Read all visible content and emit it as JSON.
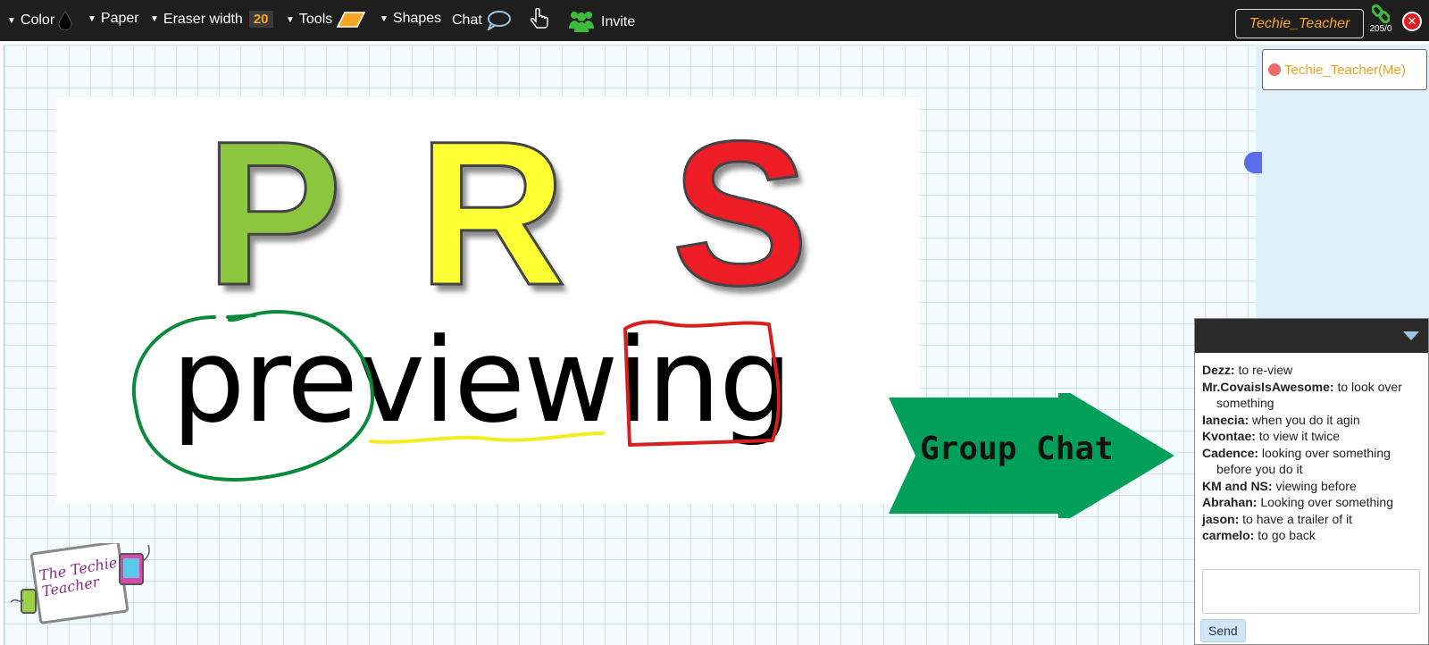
{
  "toolbar": {
    "color_label": "Color",
    "paper_label": "Paper",
    "eraser_label": "Eraser width",
    "eraser_value": "20",
    "tools_label": "Tools",
    "shapes_label": "Shapes",
    "chat_label": "Chat",
    "invite_label": "Invite",
    "user_name": "Techie_Teacher",
    "connection_count": "205/0",
    "accent_color": "#f5a623"
  },
  "members": {
    "me": "Techie_Teacher(Me)"
  },
  "slide": {
    "letters": [
      {
        "text": "P",
        "color": "#8cc63f"
      },
      {
        "text": "R",
        "color": "#ffff33"
      },
      {
        "text": "S",
        "color": "#ee1c24"
      }
    ],
    "word": "previewing",
    "arrow_label": "Group Chat",
    "arrow_color": "#00a05a",
    "logo_text": "The Techie Teacher"
  },
  "chat": {
    "messages": [
      {
        "user": "Dezz:",
        "text": "to re-view"
      },
      {
        "user": "Mr.CovaisIsAwesome:",
        "text": "to look over something"
      },
      {
        "user": "Ianecia:",
        "text": "when you do it agin"
      },
      {
        "user": "Kvontae:",
        "text": "to view it twice"
      },
      {
        "user": "Cadence:",
        "text": "looking over something before you do it"
      },
      {
        "user": "KM and NS:",
        "text": "viewing before"
      },
      {
        "user": "Abrahan:",
        "text": "Looking over something"
      },
      {
        "user": "jason:",
        "text": "to have a trailer of it"
      },
      {
        "user": "carmelo:",
        "text": "to go back"
      }
    ],
    "send_label": "Send"
  }
}
